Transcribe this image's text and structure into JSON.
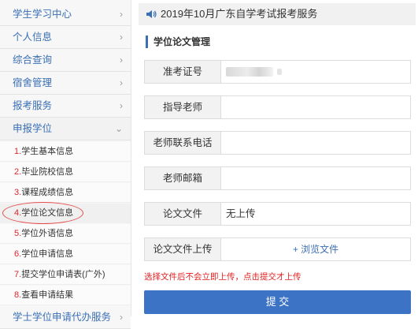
{
  "sidebar": {
    "menu": [
      {
        "label": "学生学习中心"
      },
      {
        "label": "个人信息"
      },
      {
        "label": "综合查询"
      },
      {
        "label": "宿舍管理"
      },
      {
        "label": "报考服务"
      },
      {
        "label": "申报学位"
      }
    ],
    "submenu": [
      {
        "num": "1.",
        "label": "学生基本信息"
      },
      {
        "num": "2.",
        "label": "毕业院校信息"
      },
      {
        "num": "3.",
        "label": "课程成绩信息"
      },
      {
        "num": "4.",
        "label": "学位论文信息"
      },
      {
        "num": "5.",
        "label": "学位外语信息"
      },
      {
        "num": "6.",
        "label": "学位申请信息"
      },
      {
        "num": "7.",
        "label": "提交学位申请表(广外)"
      },
      {
        "num": "8.",
        "label": "查看申请结果"
      }
    ],
    "bottom_item": {
      "label": "学士学位申请代办服务"
    }
  },
  "header": {
    "notice": "2019年10月广东自学考试报考服务",
    "icon": "speaker-icon"
  },
  "section": {
    "title": "学位论文管理"
  },
  "form": {
    "exam_id": {
      "label": "准考证号"
    },
    "advisor": {
      "label": "指导老师",
      "value": ""
    },
    "advisor_phone": {
      "label": "老师联系电话",
      "value": ""
    },
    "advisor_email": {
      "label": "老师邮箱",
      "value": ""
    },
    "thesis_file": {
      "label": "论文文件",
      "value": "无上传"
    },
    "thesis_upload": {
      "label": "论文文件上传",
      "button": "+ 浏览文件"
    }
  },
  "hint": "选择文件后不会立即上传，点击提交才上传",
  "submit_label": "提 交",
  "colors": {
    "accent": "#3a6fb4",
    "submit": "#3c73c5",
    "hint": "#e02020",
    "index": "#d9262c"
  }
}
